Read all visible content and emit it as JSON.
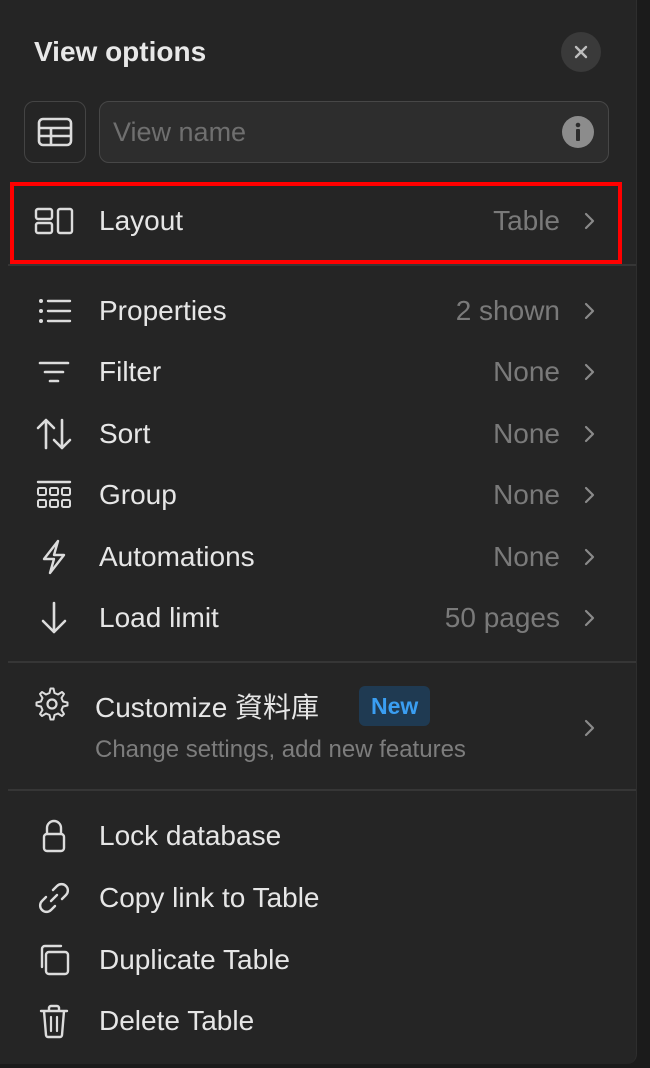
{
  "header": {
    "title": "View options"
  },
  "view_name": {
    "placeholder": "View name",
    "value": ""
  },
  "layout": {
    "label": "Layout",
    "value": "Table"
  },
  "menu": [
    {
      "id": "properties",
      "label": "Properties",
      "value": "2 shown",
      "icon": "list-icon"
    },
    {
      "id": "filter",
      "label": "Filter",
      "value": "None",
      "icon": "filter-icon"
    },
    {
      "id": "sort",
      "label": "Sort",
      "value": "None",
      "icon": "sort-icon"
    },
    {
      "id": "group",
      "label": "Group",
      "value": "None",
      "icon": "group-icon"
    },
    {
      "id": "automations",
      "label": "Automations",
      "value": "None",
      "icon": "lightning-icon"
    },
    {
      "id": "load-limit",
      "label": "Load limit",
      "value": "50 pages",
      "icon": "arrow-down-icon"
    }
  ],
  "customize": {
    "label": "Customize 資料庫",
    "badge": "New",
    "subtitle": "Change settings, add new features"
  },
  "actions": [
    {
      "id": "lock-database",
      "label": "Lock database",
      "icon": "lock-icon"
    },
    {
      "id": "copy-link",
      "label": "Copy link to Table",
      "icon": "link-icon"
    },
    {
      "id": "duplicate",
      "label": "Duplicate Table",
      "icon": "duplicate-icon"
    },
    {
      "id": "delete",
      "label": "Delete Table",
      "icon": "trash-icon"
    }
  ],
  "colors": {
    "background": "#252525",
    "highlight": "#ff0000",
    "badge_text": "#3a9ef2",
    "badge_bg": "#1f3a52"
  }
}
